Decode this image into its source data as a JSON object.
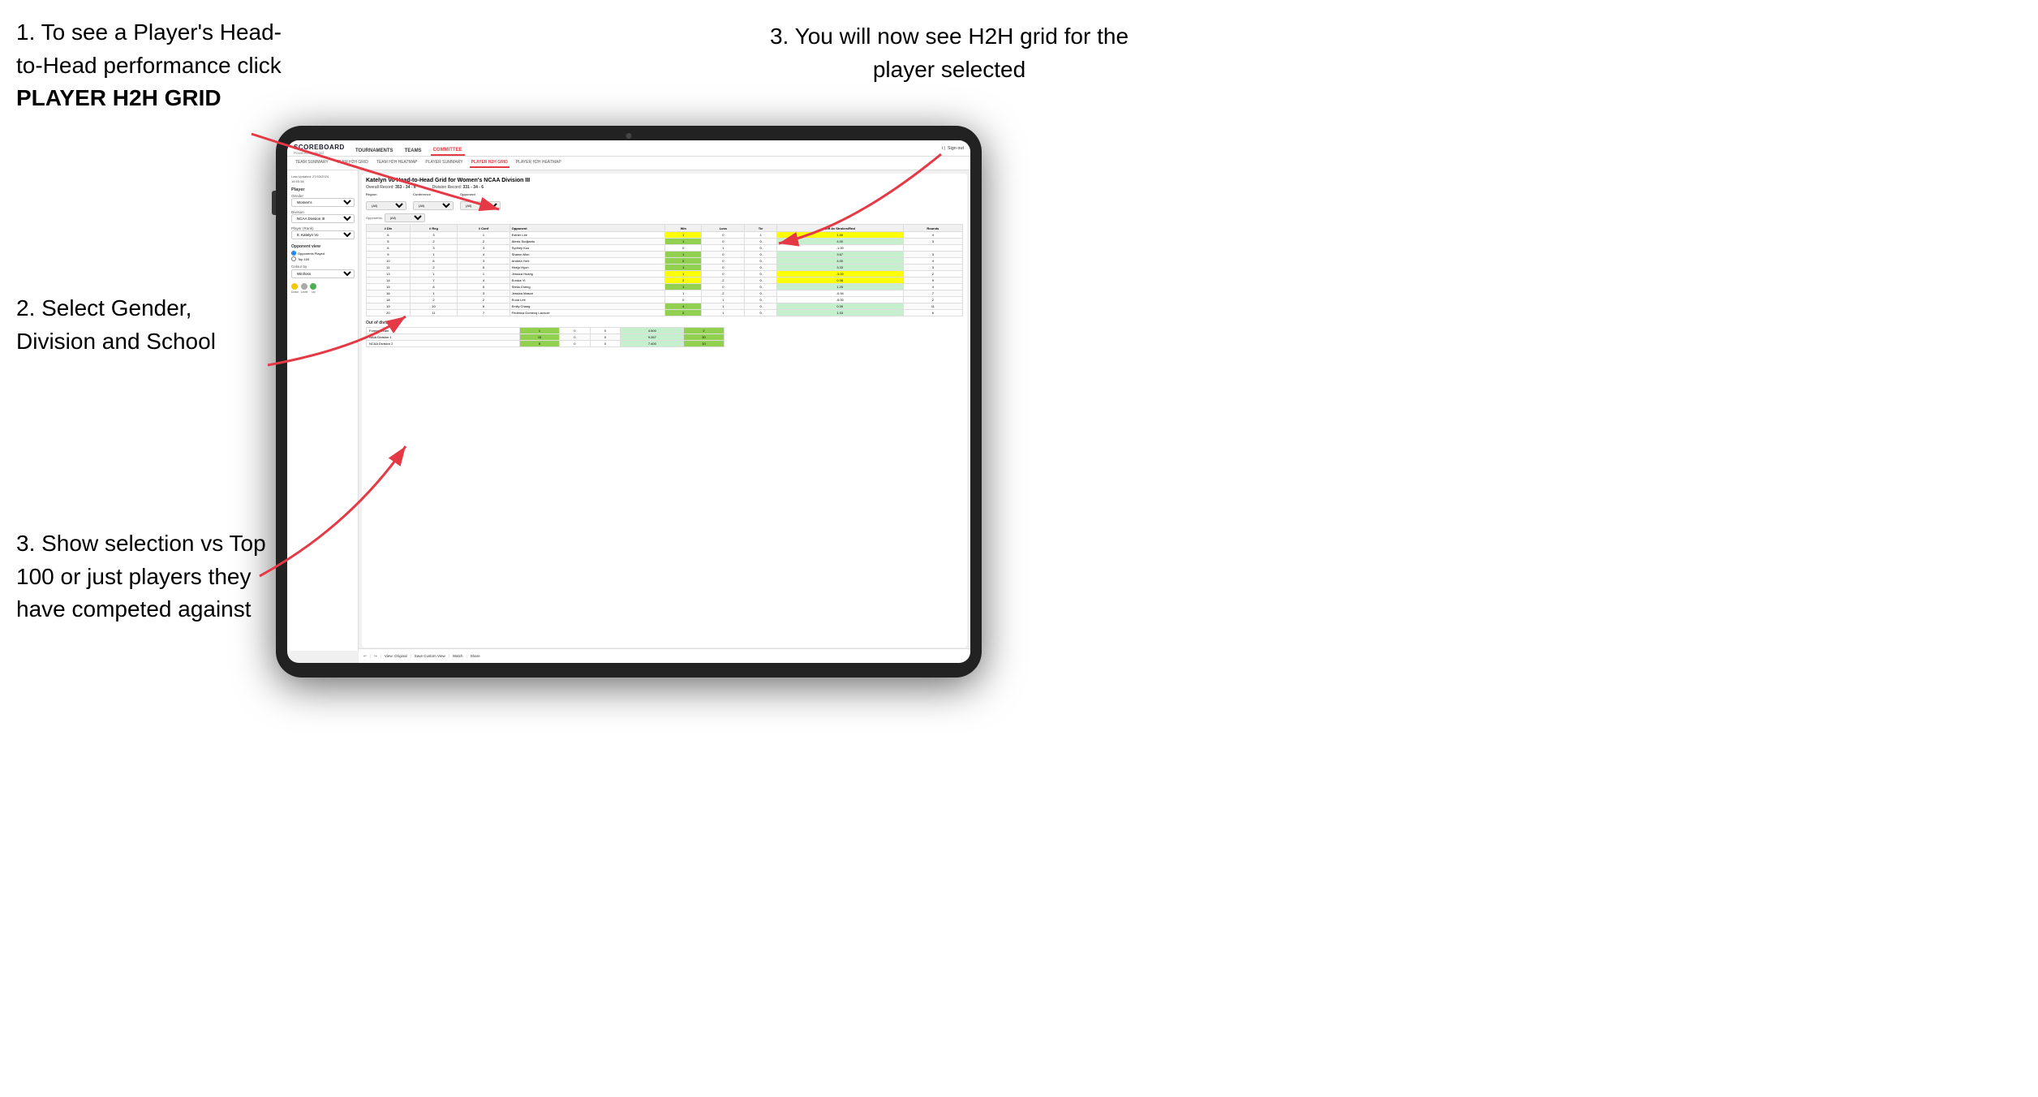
{
  "instructions": {
    "step1": "1. To see a Player's Head-to-Head performance click",
    "step1_bold": "PLAYER H2H GRID",
    "step2_title": "2. Select Gender, Division and School",
    "step3_left": "3. Show selection vs Top 100 or just players they have competed against",
    "step3_right": "3. You will now see H2H grid for the player selected"
  },
  "nav": {
    "logo": "SCOREBOARD",
    "logo_sub": "Powered by clippd",
    "items": [
      "TOURNAMENTS",
      "TEAMS",
      "COMMITTEE"
    ],
    "sign_in": "Sign out",
    "sub_items": [
      "TEAM SUMMARY",
      "TEAM H2H GRID",
      "TEAM H2H HEATMAP",
      "PLAYER SUMMARY",
      "PLAYER H2H GRID",
      "PLAYER H2H HEATMAP"
    ]
  },
  "sidebar": {
    "timestamp": "Last Updated: 27/03/2024\n16:55:38",
    "player_label": "Player",
    "gender_label": "Gender",
    "gender_value": "Women's",
    "division_label": "Division",
    "division_value": "NCAA Division III",
    "player_rank_label": "Player (Rank)",
    "player_rank_value": "8. Katelyn Vo",
    "opponent_view_label": "Opponent view",
    "radio1": "Opponents Played",
    "radio2": "Top 100",
    "colour_by_label": "Colour by",
    "colour_by_value": "Win/loss",
    "legend": [
      {
        "color": "#f4c800",
        "label": "Down"
      },
      {
        "color": "#aaaaaa",
        "label": "Level"
      },
      {
        "color": "#4caf50",
        "label": "Up"
      }
    ]
  },
  "main": {
    "title": "Katelyn Vo Head-to-Head Grid for Women's NCAA Division III",
    "overall_record_label": "Overall Record:",
    "overall_record": "353 - 34 - 6",
    "division_record_label": "Division Record:",
    "division_record": "331 - 34 - 6",
    "region_label": "Region",
    "conference_label": "Conference",
    "opponent_label": "Opponent",
    "opponents_label": "Opponents:",
    "filter_all": "(All)",
    "columns": [
      "# Div",
      "# Reg",
      "# Conf",
      "Opponent",
      "Win",
      "Loss",
      "Tie",
      "Diff Av Strokes/Rnd",
      "Rounds"
    ],
    "rows": [
      {
        "div": 6,
        "reg": 3,
        "conf": 1,
        "opponent": "Esther Lee",
        "win": 1,
        "loss": 0,
        "tie": 1,
        "diff": "1.50",
        "rounds": 4,
        "win_color": "yellow",
        "loss_color": "",
        "tie_color": ""
      },
      {
        "div": 5,
        "reg": 2,
        "conf": 2,
        "opponent": "Alexis Sudjianto",
        "win": 1,
        "loss": 0,
        "tie": 0,
        "diff": "4.00",
        "rounds": 3,
        "win_color": "green"
      },
      {
        "div": 6,
        "reg": 3,
        "conf": 3,
        "opponent": "Sydney Kuo",
        "win": 0,
        "loss": 1,
        "tie": 0,
        "diff": "-1.00",
        "rounds": "",
        "win_color": ""
      },
      {
        "div": 9,
        "reg": 1,
        "conf": 4,
        "opponent": "Sharon Mun",
        "win": 1,
        "loss": 0,
        "tie": 0,
        "diff": "3.67",
        "rounds": 3,
        "win_color": "green"
      },
      {
        "div": 10,
        "reg": 6,
        "conf": 3,
        "opponent": "Andrea York",
        "win": 2,
        "loss": 0,
        "tie": 0,
        "diff": "4.00",
        "rounds": 4,
        "win_color": "green"
      },
      {
        "div": 11,
        "reg": 2,
        "conf": 5,
        "opponent": "Heejo Hyun",
        "win": 1,
        "loss": 0,
        "tie": 0,
        "diff": "3.33",
        "rounds": 3,
        "win_color": "green"
      },
      {
        "div": 13,
        "reg": 1,
        "conf": 1,
        "opponent": "Jessica Huang",
        "win": 1,
        "loss": 0,
        "tie": 0,
        "diff": "-3.00",
        "rounds": 2,
        "win_color": "yellow"
      },
      {
        "div": 14,
        "reg": 7,
        "conf": 4,
        "opponent": "Eunice Yi",
        "win": 2,
        "loss": 2,
        "tie": 0,
        "diff": "0.38",
        "rounds": 9,
        "win_color": "yellow"
      },
      {
        "div": 15,
        "reg": 8,
        "conf": 5,
        "opponent": "Stella Cheng",
        "win": 1,
        "loss": 0,
        "tie": 0,
        "diff": "1.25",
        "rounds": 4,
        "win_color": "green"
      },
      {
        "div": 16,
        "reg": 1,
        "conf": 3,
        "opponent": "Jessica Mason",
        "win": 1,
        "loss": 2,
        "tie": 0,
        "diff": "-0.94",
        "rounds": 7,
        "win_color": ""
      },
      {
        "div": 18,
        "reg": 2,
        "conf": 2,
        "opponent": "Euna Lee",
        "win": 0,
        "loss": 1,
        "tie": 0,
        "diff": "-5.00",
        "rounds": 2,
        "win_color": ""
      },
      {
        "div": 19,
        "reg": 10,
        "conf": 6,
        "opponent": "Emily Chang",
        "win": 4,
        "loss": 1,
        "tie": 0,
        "diff": "0.30",
        "rounds": 11,
        "win_color": "green"
      },
      {
        "div": 20,
        "reg": 11,
        "conf": 7,
        "opponent": "Federica Domecq Lacroze",
        "win": 2,
        "loss": 1,
        "tie": 0,
        "diff": "1.33",
        "rounds": 6,
        "win_color": "green"
      }
    ],
    "out_of_division_label": "Out of division",
    "ood_rows": [
      {
        "label": "Foreign Team",
        "win": 1,
        "loss": 0,
        "tie": 0,
        "diff": "4.500",
        "rounds": 2
      },
      {
        "label": "NAIA Division 1",
        "win": 15,
        "loss": 0,
        "tie": 0,
        "diff": "9.267",
        "rounds": 30
      },
      {
        "label": "NCAA Division 2",
        "win": 5,
        "loss": 0,
        "tie": 0,
        "diff": "7.400",
        "rounds": 10
      }
    ]
  },
  "toolbar": {
    "view_original": "View: Original",
    "save_custom": "Save Custom View",
    "watch": "Watch",
    "share": "Share"
  }
}
